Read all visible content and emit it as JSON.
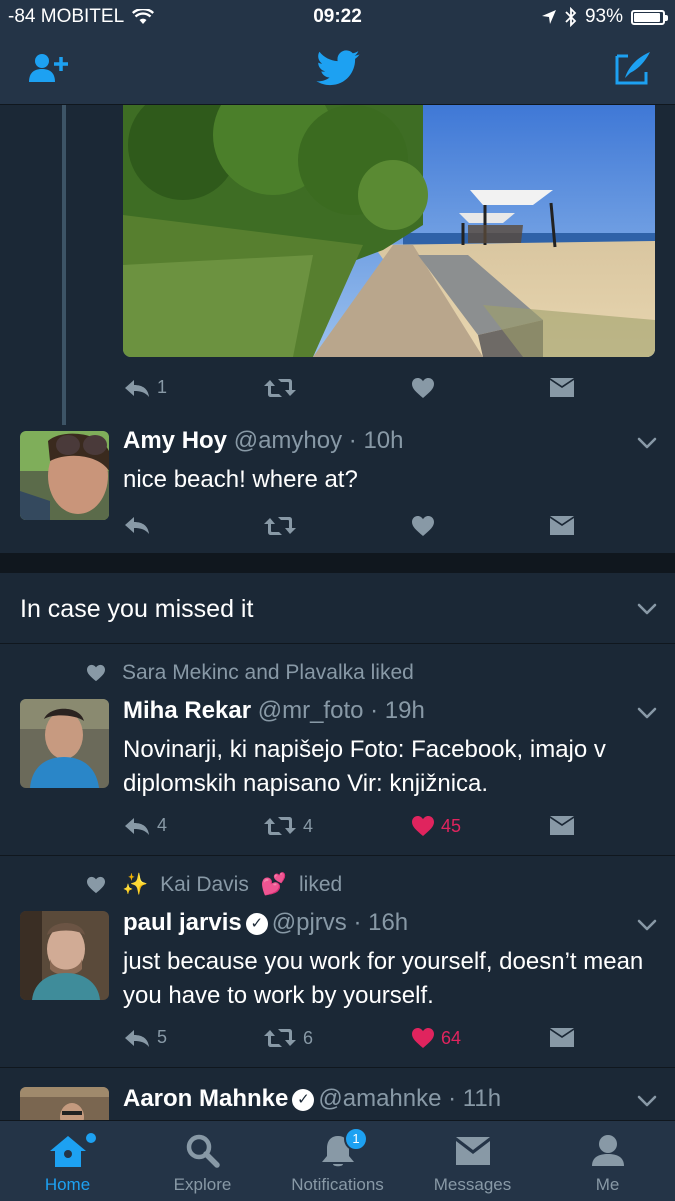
{
  "status_bar": {
    "carrier": "-84 MOBITEL",
    "time": "09:22",
    "battery": "93%",
    "battery_level": 0.93
  },
  "colors": {
    "accent": "#1da1f2",
    "like": "#e0245e",
    "muted": "#8899a6",
    "background": "#1b2836",
    "bar": "#243447"
  },
  "nav": {
    "left_icon": "add-user-icon",
    "center_icon": "twitter-bird-icon",
    "right_icon": "compose-icon"
  },
  "top_tweet": {
    "reply_count": "1"
  },
  "reply_tweet": {
    "name": "Amy Hoy",
    "handle": "@amyhoy",
    "time": "· 10h",
    "text": "nice beach! where at?"
  },
  "section": {
    "title": "In case you missed it"
  },
  "tweet1": {
    "social_context": "Sara Mekinc and Plavalka liked",
    "name": "Miha Rekar",
    "handle": "@mr_foto",
    "time": "· 19h",
    "text": "Novinarji, ki napišejo Foto: Facebook, imajo v diplomskih napisano Vir: knjižnica.",
    "replies": "4",
    "retweets": "4",
    "likes": "45"
  },
  "tweet2": {
    "social_context_prefix": "✨",
    "social_context_name": "Kai Davis",
    "social_context_emoji": "💕",
    "social_context_suffix": "liked",
    "name": "paul jarvis",
    "verified_mark": "✓",
    "handle": "@pjrvs",
    "time": "· 16h",
    "text": "just because you work for yourself, doesn’t mean you have to work by yourself.",
    "replies": "5",
    "retweets": "6",
    "likes": "64"
  },
  "tweet3": {
    "name": "Aaron Mahnke",
    "verified_mark": "✓",
    "handle": "@amahnke",
    "time": "· 11h"
  },
  "tabs": [
    {
      "label": "Home",
      "icon": "home-icon"
    },
    {
      "label": "Explore",
      "icon": "search-icon"
    },
    {
      "label": "Notifications",
      "icon": "bell-icon",
      "badge": "1"
    },
    {
      "label": "Messages",
      "icon": "envelope-icon"
    },
    {
      "label": "Me",
      "icon": "person-icon"
    }
  ]
}
